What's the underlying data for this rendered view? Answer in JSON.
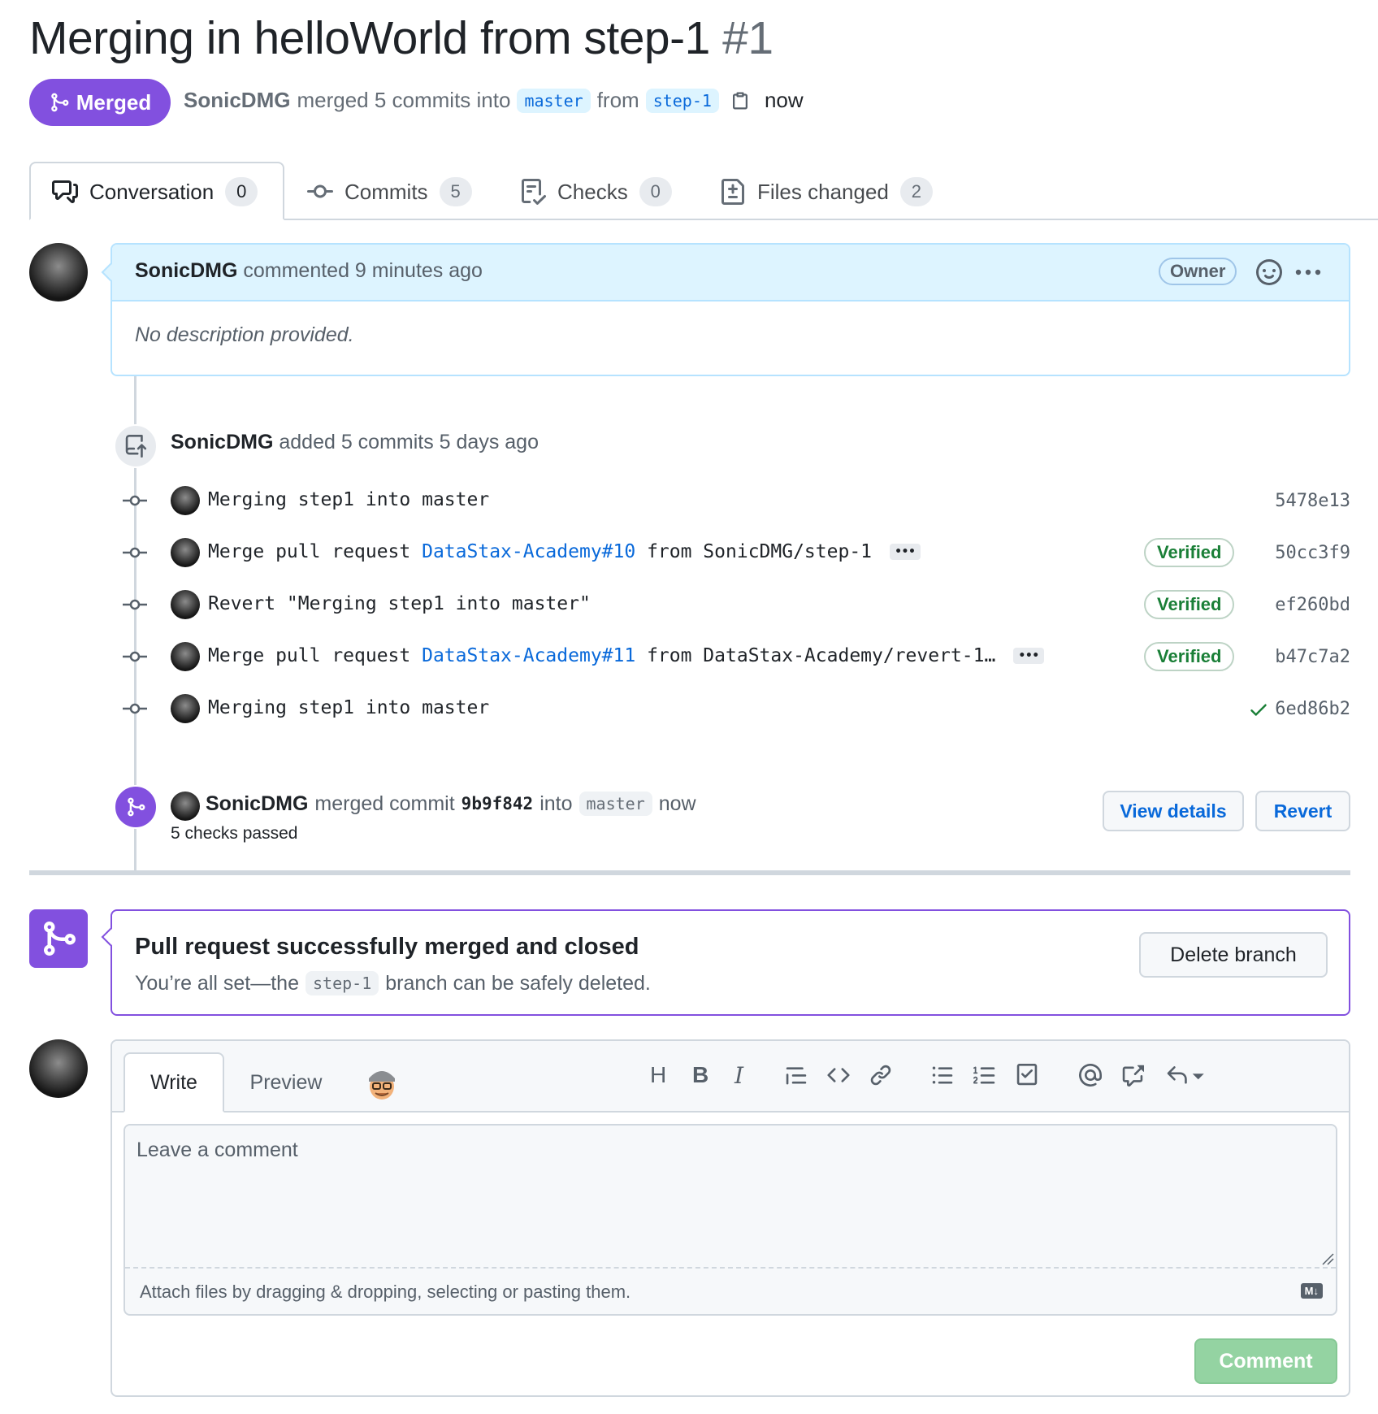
{
  "title": {
    "text": "Merging in helloWorld from step-1",
    "number": "#1"
  },
  "state": {
    "badge": "Merged",
    "author": "SonicDMG",
    "action": "merged 5 commits into",
    "base_branch": "master",
    "from": "from",
    "head_branch": "step-1",
    "time": "now"
  },
  "tabs": [
    {
      "label": "Conversation",
      "count": "0"
    },
    {
      "label": "Commits",
      "count": "5"
    },
    {
      "label": "Checks",
      "count": "0"
    },
    {
      "label": "Files changed",
      "count": "2"
    }
  ],
  "comment": {
    "author": "SonicDMG",
    "meta": "commented 9 minutes ago",
    "role": "Owner",
    "body": "No description provided."
  },
  "commits_event": {
    "author": "SonicDMG",
    "text": "added 5 commits 5 days ago"
  },
  "commits": [
    {
      "pre": "Merging step1 into master",
      "link": "",
      "post": "",
      "verified": "",
      "sha": "5478e13"
    },
    {
      "pre": "Merge pull request ",
      "link": "DataStax-Academy#10",
      "post": " from SonicDMG/step-1",
      "verified": "Verified",
      "sha": "50cc3f9"
    },
    {
      "pre": "Revert \"Merging step1 into master\"",
      "link": "",
      "post": "",
      "verified": "Verified",
      "sha": "ef260bd"
    },
    {
      "pre": "Merge pull request ",
      "link": "DataStax-Academy#11",
      "post": " from DataStax-Academy/revert-1…",
      "verified": "Verified",
      "sha": "b47c7a2"
    },
    {
      "pre": "Merging step1 into master",
      "link": "",
      "post": "",
      "verified": "",
      "sha": "6ed86b2"
    }
  ],
  "merge_event": {
    "author": "SonicDMG",
    "text1": "merged commit",
    "sha": "9b9f842",
    "text2": "into",
    "branch": "master",
    "time": "now",
    "checks": "5 checks passed",
    "view_details": "View details",
    "revert": "Revert"
  },
  "merged_box": {
    "title": "Pull request successfully merged and closed",
    "text_pre": "You’re all set—the",
    "branch": "step-1",
    "text_post": "branch can be safely deleted.",
    "delete_button": "Delete branch"
  },
  "editor": {
    "tab_write": "Write",
    "tab_preview": "Preview",
    "placeholder": "Leave a comment",
    "attach_hint": "Attach files by dragging & dropping, selecting or pasting them.",
    "submit": "Comment",
    "heading_glyph": "H",
    "bold_glyph": "B",
    "italic_glyph": "I",
    "markdown_badge": "M↓"
  },
  "colors": {
    "merged": "#8250df",
    "link": "#0969da",
    "success": "#1a7f37",
    "comment_button": "#94d3a2"
  }
}
